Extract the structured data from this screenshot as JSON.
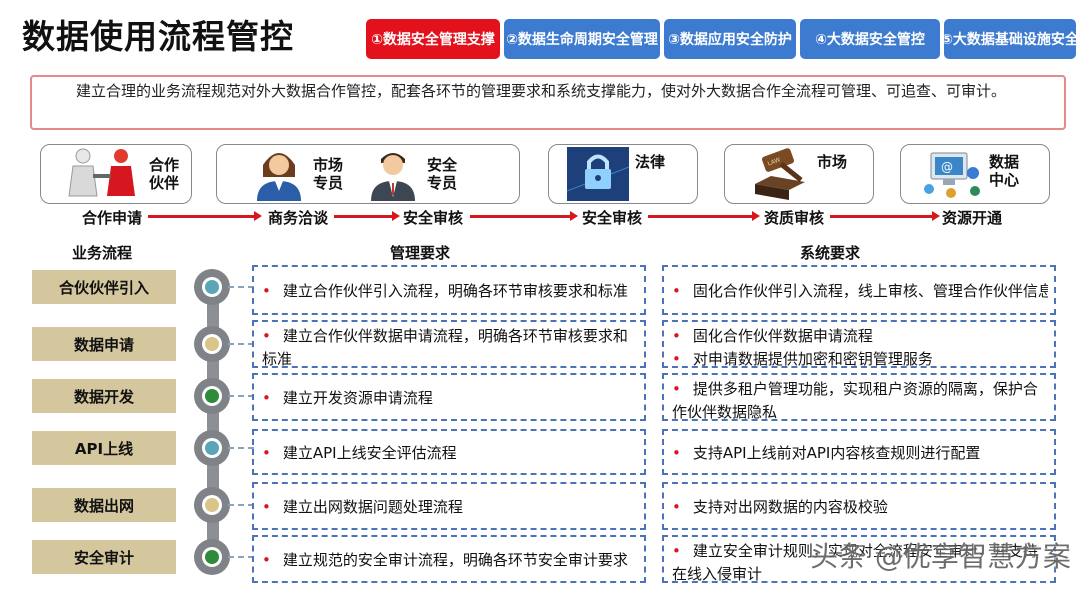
{
  "title": "数据使用流程管控",
  "tabs": [
    "①数据安全管理支撑",
    "②数据生命周期安全管理",
    "③数据应用安全防护",
    "④大数据安全管控",
    "⑤大数据基础设施安全"
  ],
  "intro": "建立合理的业务流程规范对外大数据合作管控，配套各环节的管理要求和系统支撑能力，使对外大数据合作全流程可管理、可追查、可审计。",
  "cards": {
    "partner": "合作伙伴",
    "market_specialist": "市场专员",
    "security_specialist": "安全专员",
    "law": "法律",
    "market": "市场",
    "data_center": "数据中心"
  },
  "flow_steps": [
    "合作申请",
    "商务洽谈",
    "安全审核",
    "安全审核",
    "资质审核",
    "资源开通"
  ],
  "headers": {
    "process": "业务流程",
    "management": "管理要求",
    "system": "系统要求"
  },
  "process_steps": [
    "合伙伙伴引入",
    "数据申请",
    "数据开发",
    "API上线",
    "数据出网",
    "安全审计"
  ],
  "node_colors": [
    "#5aa6b8",
    "#d9c48a",
    "#2e8b3a",
    "#5aa6b8",
    "#d9c48a",
    "#2e8b3a"
  ],
  "bullet_char": "•",
  "management": [
    [
      "建立合作伙伴引入流程，明确各环节审核要求和标准"
    ],
    [
      "建立合作伙伴数据申请流程，明确各环节审核要求和标准"
    ],
    [
      "建立开发资源申请流程"
    ],
    [
      "建立API上线安全评估流程"
    ],
    [
      "建立出网数据问题处理流程"
    ],
    [
      "建立规范的安全审计流程，明确各环节安全审计要求"
    ]
  ],
  "system": [
    [
      "固化合作伙伴引入流程，线上审核、管理合作伙伴信息"
    ],
    [
      "固化合作伙伴数据申请流程",
      "对申请数据提供加密和密钥管理服务"
    ],
    [
      "提供多租户管理功能，实现租户资源的隔离，保护合作伙伴数据隐私"
    ],
    [
      "支持API上线前对API内容核查规则进行配置"
    ],
    [
      "支持对出网数据的内容极校验"
    ],
    [
      "建立安全审计规则，实现对全流程安全审计，并支持在线入侵审计"
    ]
  ],
  "watermark": "头条 @优享智慧方案"
}
